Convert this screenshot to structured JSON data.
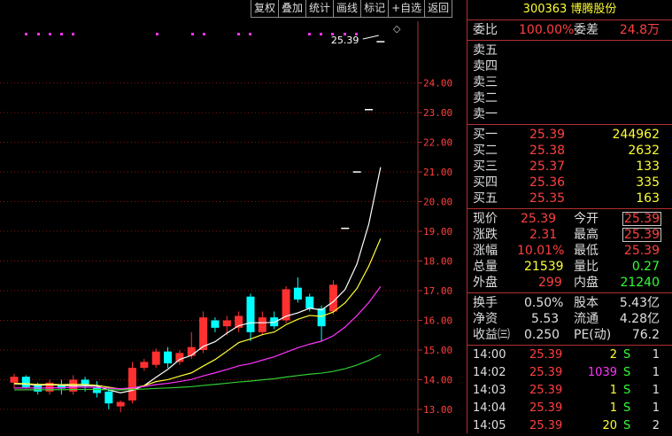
{
  "toolbar": [
    "复权",
    "叠加",
    "统计",
    "画线",
    "标记",
    "+自选",
    "返回"
  ],
  "stock": {
    "code": "300363",
    "name": "博腾股份"
  },
  "price_axis": {
    "labels": [
      "24.00",
      "23.00",
      "22.00",
      "21.00",
      "20.00",
      "19.00",
      "18.00",
      "17.00",
      "16.00",
      "15.00",
      "14.00",
      "13.00"
    ],
    "max_label": "25.39"
  },
  "ratio": {
    "label1": "委比",
    "value1": "100.00%",
    "label2": "委差",
    "value2": "24.8万"
  },
  "sell": [
    {
      "label": "卖五",
      "price": "",
      "vol": ""
    },
    {
      "label": "卖四",
      "price": "",
      "vol": ""
    },
    {
      "label": "卖三",
      "price": "",
      "vol": ""
    },
    {
      "label": "卖二",
      "price": "",
      "vol": ""
    },
    {
      "label": "卖一",
      "price": "",
      "vol": ""
    }
  ],
  "buy": [
    {
      "label": "买一",
      "price": "25.39",
      "vol": "244962"
    },
    {
      "label": "买二",
      "price": "25.38",
      "vol": "2632"
    },
    {
      "label": "买三",
      "price": "25.37",
      "vol": "133"
    },
    {
      "label": "买四",
      "price": "25.36",
      "vol": "335"
    },
    {
      "label": "买五",
      "price": "25.35",
      "vol": "163"
    }
  ],
  "quote": [
    {
      "l1": "现价",
      "v1": "25.39",
      "l2": "今开",
      "v2": "25.39"
    },
    {
      "l1": "涨跌",
      "v1": "2.31",
      "l2": "最高",
      "v2": "25.39"
    },
    {
      "l1": "涨幅",
      "v1": "10.01%",
      "l2": "最低",
      "v2": "25.39"
    },
    {
      "l1": "总量",
      "v1": "21539",
      "l2": "量比",
      "v2": "0.27"
    },
    {
      "l1": "外盘",
      "v1": "299",
      "l2": "内盘",
      "v2": "21240"
    }
  ],
  "fund": [
    {
      "l1": "换手",
      "v1": "0.50%",
      "l2": "股本",
      "v2": "5.43亿"
    },
    {
      "l1": "净资",
      "v1": "5.53",
      "l2": "流通",
      "v2": "4.28亿"
    },
    {
      "l1": "收益㈢",
      "v1": "0.250",
      "l2": "PE(动)",
      "v2": "76.2"
    }
  ],
  "ticks": [
    {
      "time": "14:00",
      "price": "25.39",
      "vol": "2",
      "side": "S",
      "count": "1"
    },
    {
      "time": "14:02",
      "price": "25.39",
      "vol": "1039",
      "side": "S",
      "count": "1"
    },
    {
      "time": "14:03",
      "price": "25.39",
      "vol": "1",
      "side": "S",
      "count": "1"
    },
    {
      "time": "14:04",
      "price": "25.39",
      "vol": "1",
      "side": "S",
      "count": "1"
    },
    {
      "time": "14:05",
      "price": "25.39",
      "vol": "20",
      "side": "S",
      "count": "2"
    }
  ],
  "colors": {
    "up": "#ff3030",
    "down": "#00ffff",
    "ma5": "#ffffff",
    "ma10": "#ffff33",
    "ma20": "#ff33ff",
    "ma60": "#33cc33"
  },
  "chart_data": {
    "type": "candlestick",
    "ylim": [
      12.7,
      25.6
    ],
    "candles": [
      {
        "o": 13.9,
        "c": 14.1,
        "h": 14.2,
        "l": 13.7
      },
      {
        "o": 14.1,
        "c": 13.75,
        "h": 14.15,
        "l": 13.7
      },
      {
        "o": 13.8,
        "c": 13.6,
        "h": 13.9,
        "l": 13.5
      },
      {
        "o": 13.6,
        "c": 13.9,
        "h": 14.0,
        "l": 13.5
      },
      {
        "o": 13.85,
        "c": 13.7,
        "h": 14.0,
        "l": 13.5
      },
      {
        "o": 13.6,
        "c": 14.0,
        "h": 14.15,
        "l": 13.5
      },
      {
        "o": 14.0,
        "c": 13.8,
        "h": 14.1,
        "l": 13.6
      },
      {
        "o": 13.75,
        "c": 13.55,
        "h": 13.95,
        "l": 13.4
      },
      {
        "o": 13.6,
        "c": 13.2,
        "h": 13.7,
        "l": 13.0
      },
      {
        "o": 13.1,
        "c": 13.25,
        "h": 13.3,
        "l": 12.9
      },
      {
        "o": 13.3,
        "c": 14.4,
        "h": 14.6,
        "l": 13.2
      },
      {
        "o": 14.4,
        "c": 14.6,
        "h": 14.7,
        "l": 14.3
      },
      {
        "o": 14.5,
        "c": 14.95,
        "h": 15.05,
        "l": 14.4
      },
      {
        "o": 14.95,
        "c": 14.55,
        "h": 15.1,
        "l": 14.4
      },
      {
        "o": 14.6,
        "c": 14.9,
        "h": 15.0,
        "l": 14.5
      },
      {
        "o": 14.8,
        "c": 15.1,
        "h": 15.6,
        "l": 14.7
      },
      {
        "o": 15.0,
        "c": 16.1,
        "h": 16.3,
        "l": 14.9
      },
      {
        "o": 16.0,
        "c": 15.75,
        "h": 16.1,
        "l": 15.6
      },
      {
        "o": 15.8,
        "c": 16.0,
        "h": 16.15,
        "l": 15.5
      },
      {
        "o": 15.75,
        "c": 16.15,
        "h": 16.3,
        "l": 15.6
      },
      {
        "o": 16.8,
        "c": 15.6,
        "h": 16.9,
        "l": 15.3
      },
      {
        "o": 15.6,
        "c": 16.1,
        "h": 16.3,
        "l": 15.5
      },
      {
        "o": 16.1,
        "c": 15.8,
        "h": 16.3,
        "l": 15.7
      },
      {
        "o": 16.0,
        "c": 17.05,
        "h": 17.15,
        "l": 15.9
      },
      {
        "o": 17.1,
        "c": 16.7,
        "h": 17.45,
        "l": 16.6
      },
      {
        "o": 16.8,
        "c": 16.4,
        "h": 16.9,
        "l": 16.3
      },
      {
        "o": 16.4,
        "c": 15.8,
        "h": 16.5,
        "l": 15.3
      },
      {
        "o": 16.3,
        "c": 17.2,
        "h": 17.35,
        "l": 16.2
      },
      {
        "o": 19.1,
        "c": 19.1,
        "h": 19.1,
        "l": 19.1
      },
      {
        "o": 21.0,
        "c": 21.0,
        "h": 21.0,
        "l": 21.0
      },
      {
        "o": 23.1,
        "c": 23.1,
        "h": 23.1,
        "l": 23.1
      },
      {
        "o": 25.39,
        "c": 25.39,
        "h": 25.39,
        "l": 25.39
      }
    ]
  }
}
